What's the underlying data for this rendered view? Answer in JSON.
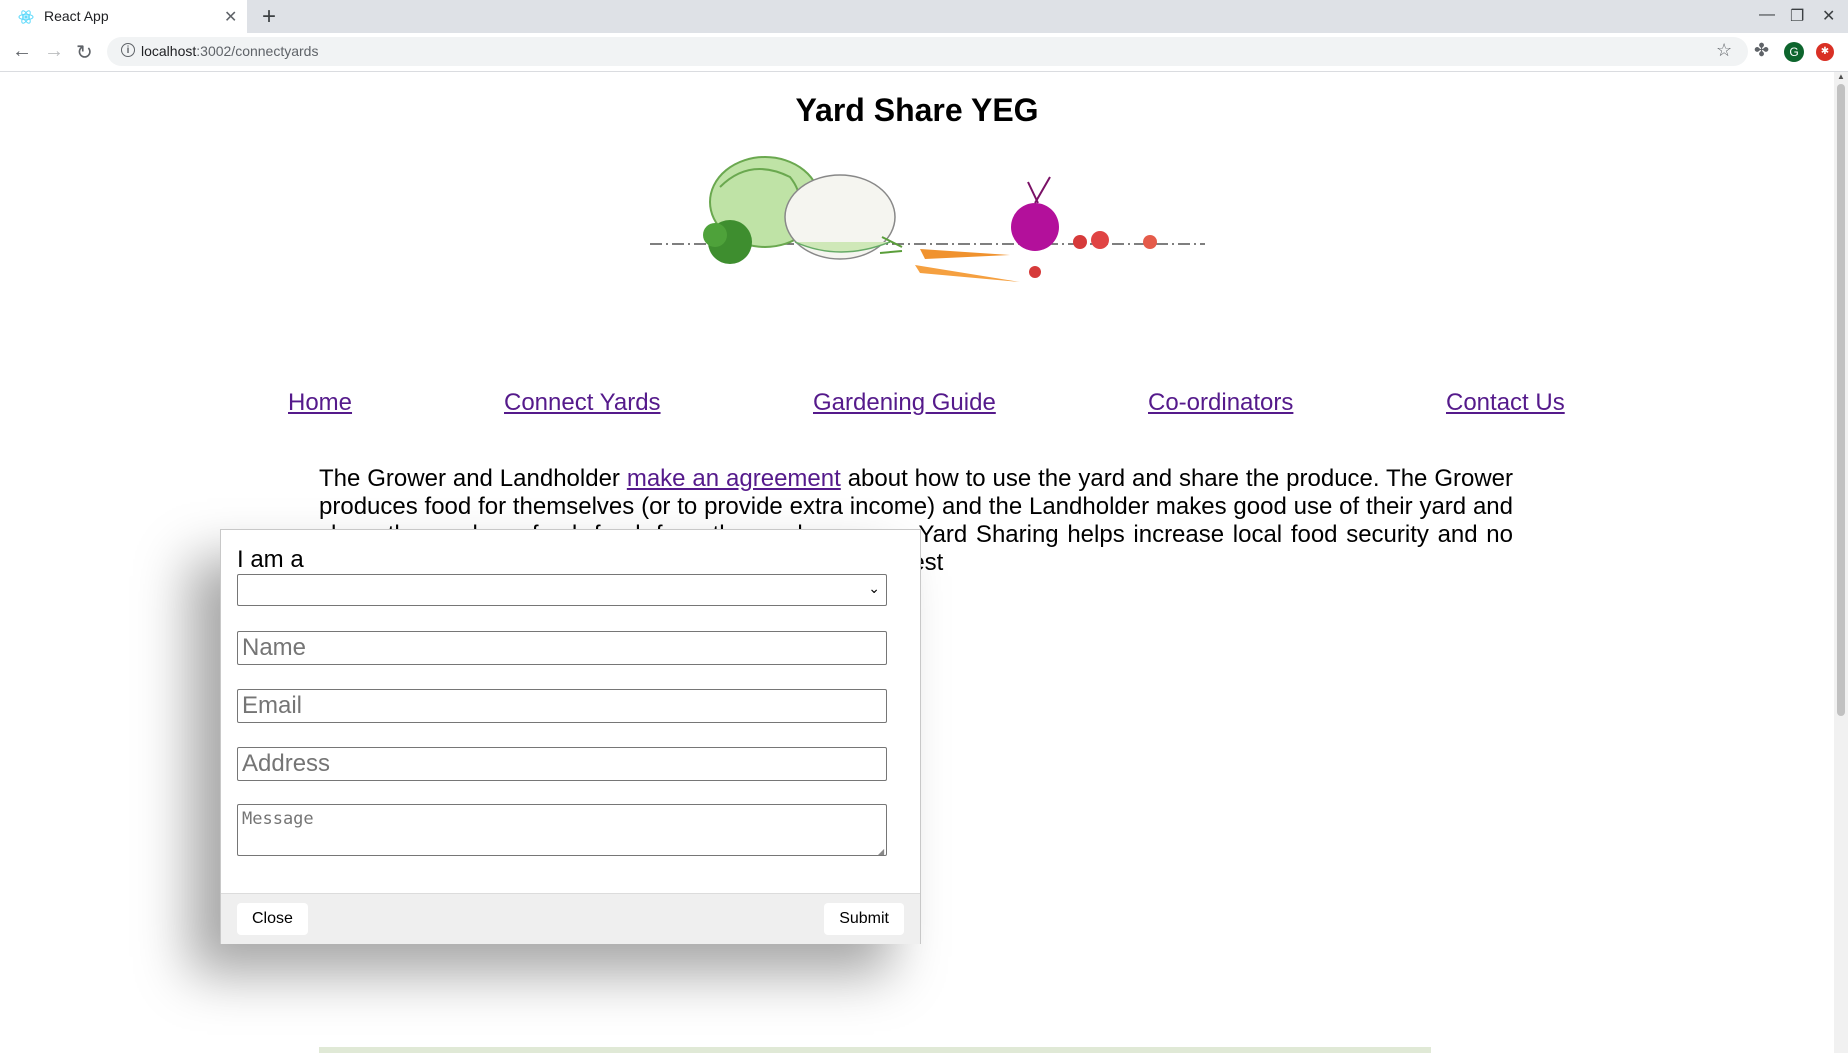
{
  "browser": {
    "tab_title": "React App",
    "url_host": "localhost",
    "url_rest": ":3002/connectyards",
    "avatar_letter": "G"
  },
  "page": {
    "title": "Yard Share YEG",
    "nav": [
      {
        "label": "Home"
      },
      {
        "label": "Connect Yards"
      },
      {
        "label": "Gardening Guide"
      },
      {
        "label": "Co-ordinators"
      },
      {
        "label": "Contact Us"
      }
    ],
    "para_before": "The Grower and Landholder ",
    "para_link": "make an agreement",
    "para_after": " about how to use the yard and share the produce. The Grower produces food for themselves (or to provide extra income) and the Landholder makes good use of their yard and share the produce, fresh food, from the garden grown. Yard Sharing helps increase local food security and no rent is charged for the use of the yard. - Sundance Harvest"
  },
  "modal": {
    "select_label": "I am a",
    "select_value": "",
    "name_placeholder": "Name",
    "email_placeholder": "Email",
    "address_placeholder": "Address",
    "message_placeholder": "Message",
    "close_label": "Close",
    "submit_label": "Submit"
  },
  "colors": {
    "link_visited": "#551a8b",
    "modal_footer": "#efefef"
  }
}
